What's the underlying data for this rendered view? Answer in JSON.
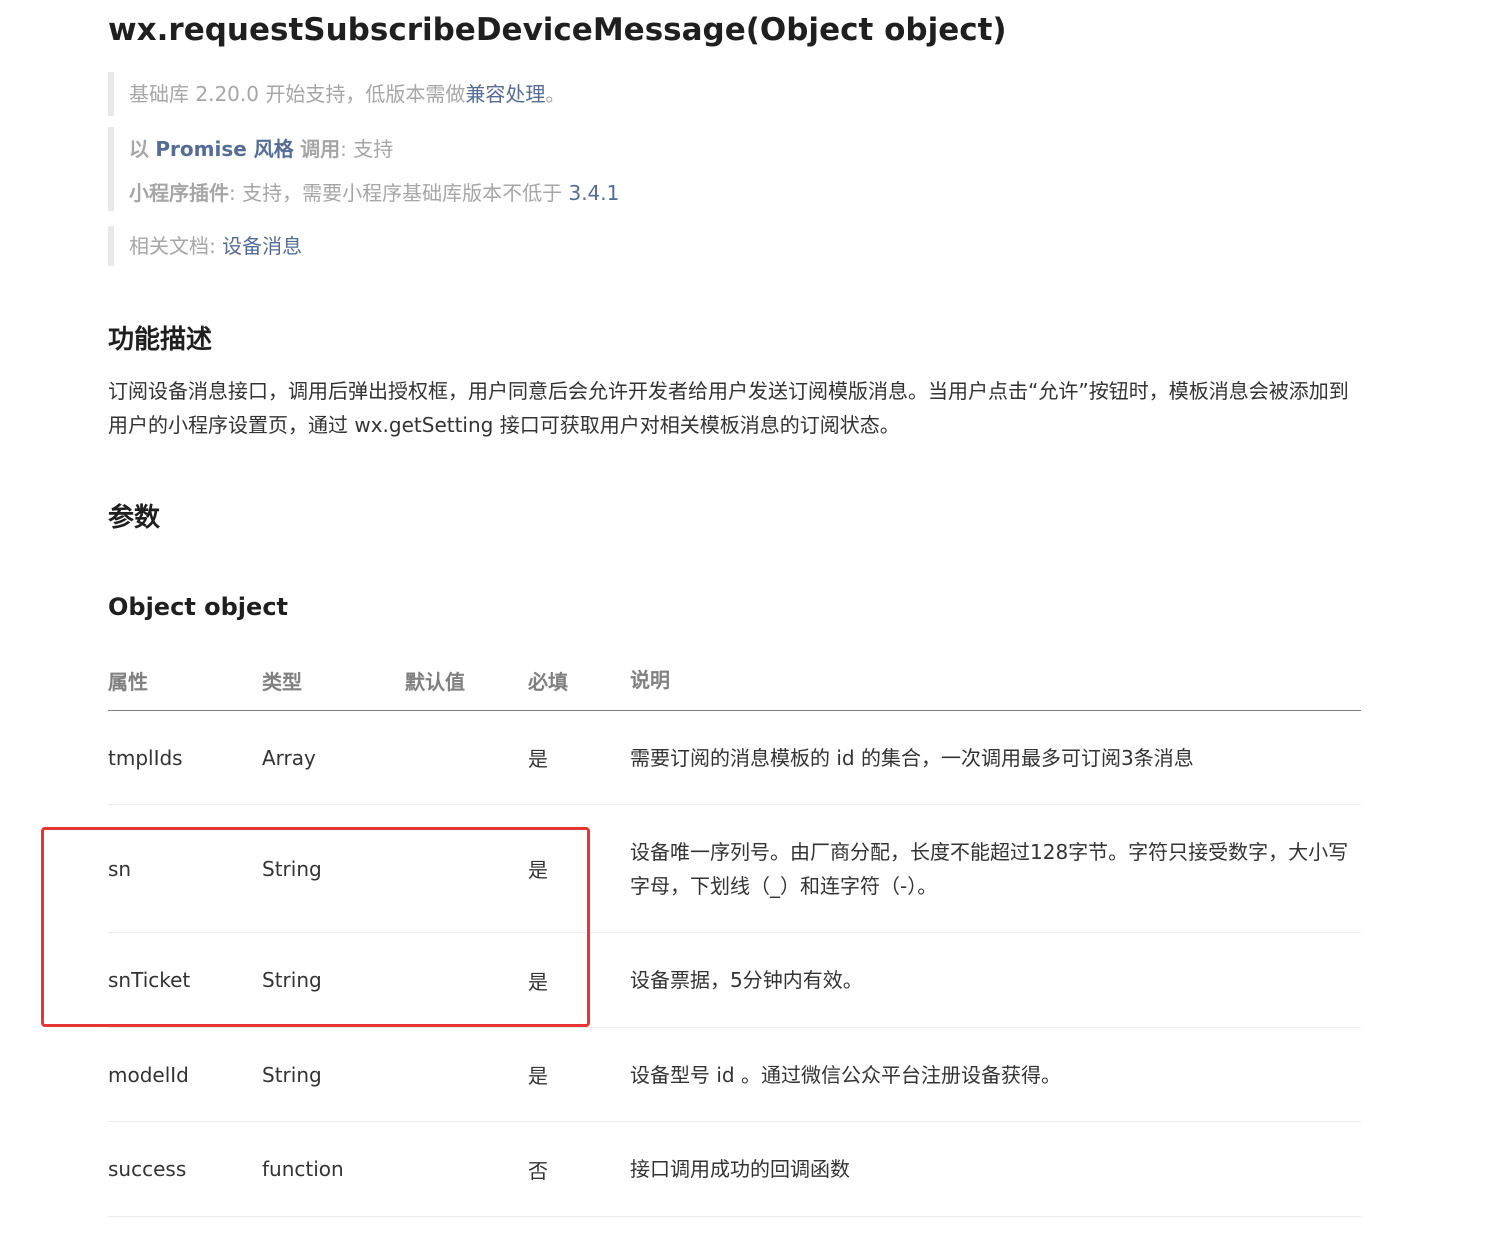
{
  "title": "wx.requestSubscribeDeviceMessage(Object object)",
  "notes": {
    "base_lib_prefix": "基础库 2.20.0 开始支持，低版本需做",
    "compat_link": "兼容处理",
    "base_lib_suffix": "。",
    "promise_prefix": "以",
    "promise_link": "Promise 风格",
    "promise_call": "调用",
    "promise_value": ": 支持",
    "plugin_label": "小程序插件",
    "plugin_value": ": 支持，需要小程序基础库版本不低于",
    "plugin_version": "3.4.1",
    "related_label": "相关文档: ",
    "related_link": "设备消息"
  },
  "sections": {
    "function_heading": "功能描述",
    "function_desc": "订阅设备消息接口，调用后弹出授权框，用户同意后会允许开发者给用户发送订阅模版消息。当用户点击“允许”按钮时，模板消息会被添加到用户的小程序设置页，通过 wx.getSetting 接口可获取用户对相关模板消息的订阅状态。",
    "params_heading": "参数",
    "object_heading": "Object object"
  },
  "table": {
    "headers": [
      "属性",
      "类型",
      "默认值",
      "必填",
      "说明"
    ],
    "rows": [
      {
        "name": "tmplIds",
        "type": "Array",
        "default": "",
        "required": "是",
        "desc": "需要订阅的消息模板的 id 的集合，一次调用最多可订阅3条消息"
      },
      {
        "name": "sn",
        "type": "String",
        "default": "",
        "required": "是",
        "desc": "设备唯一序列号。由厂商分配，长度不能超过128字节。字符只接受数字，大小写字母，下划线（_）和连字符（-）。"
      },
      {
        "name": "snTicket",
        "type": "String",
        "default": "",
        "required": "是",
        "desc": "设备票据，5分钟内有效。"
      },
      {
        "name": "modelId",
        "type": "String",
        "default": "",
        "required": "是",
        "desc": "设备型号 id 。通过微信公众平台注册设备获得。"
      },
      {
        "name": "success",
        "type": "function",
        "default": "",
        "required": "否",
        "desc": "接口调用成功的回调函数"
      }
    ]
  },
  "colors": {
    "link": "#556c95",
    "highlight_border": "#e63535"
  }
}
